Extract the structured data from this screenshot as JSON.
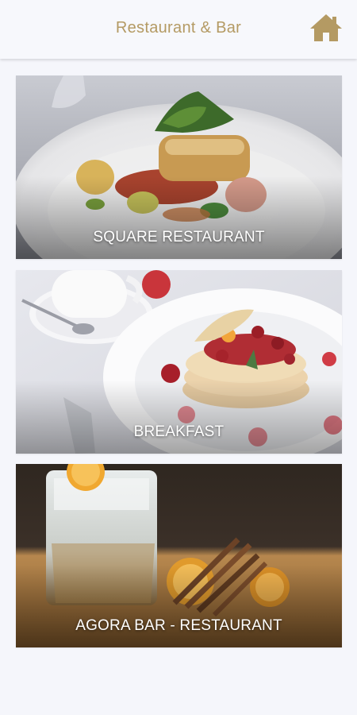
{
  "header": {
    "title": "Restaurant & Bar",
    "home_icon": "home-icon",
    "accent_color": "#b49a63"
  },
  "cards": [
    {
      "label": "SQUARE RESTAURANT"
    },
    {
      "label": "BREAKFAST"
    },
    {
      "label": "AGORA BAR - RESTAURANT"
    }
  ]
}
